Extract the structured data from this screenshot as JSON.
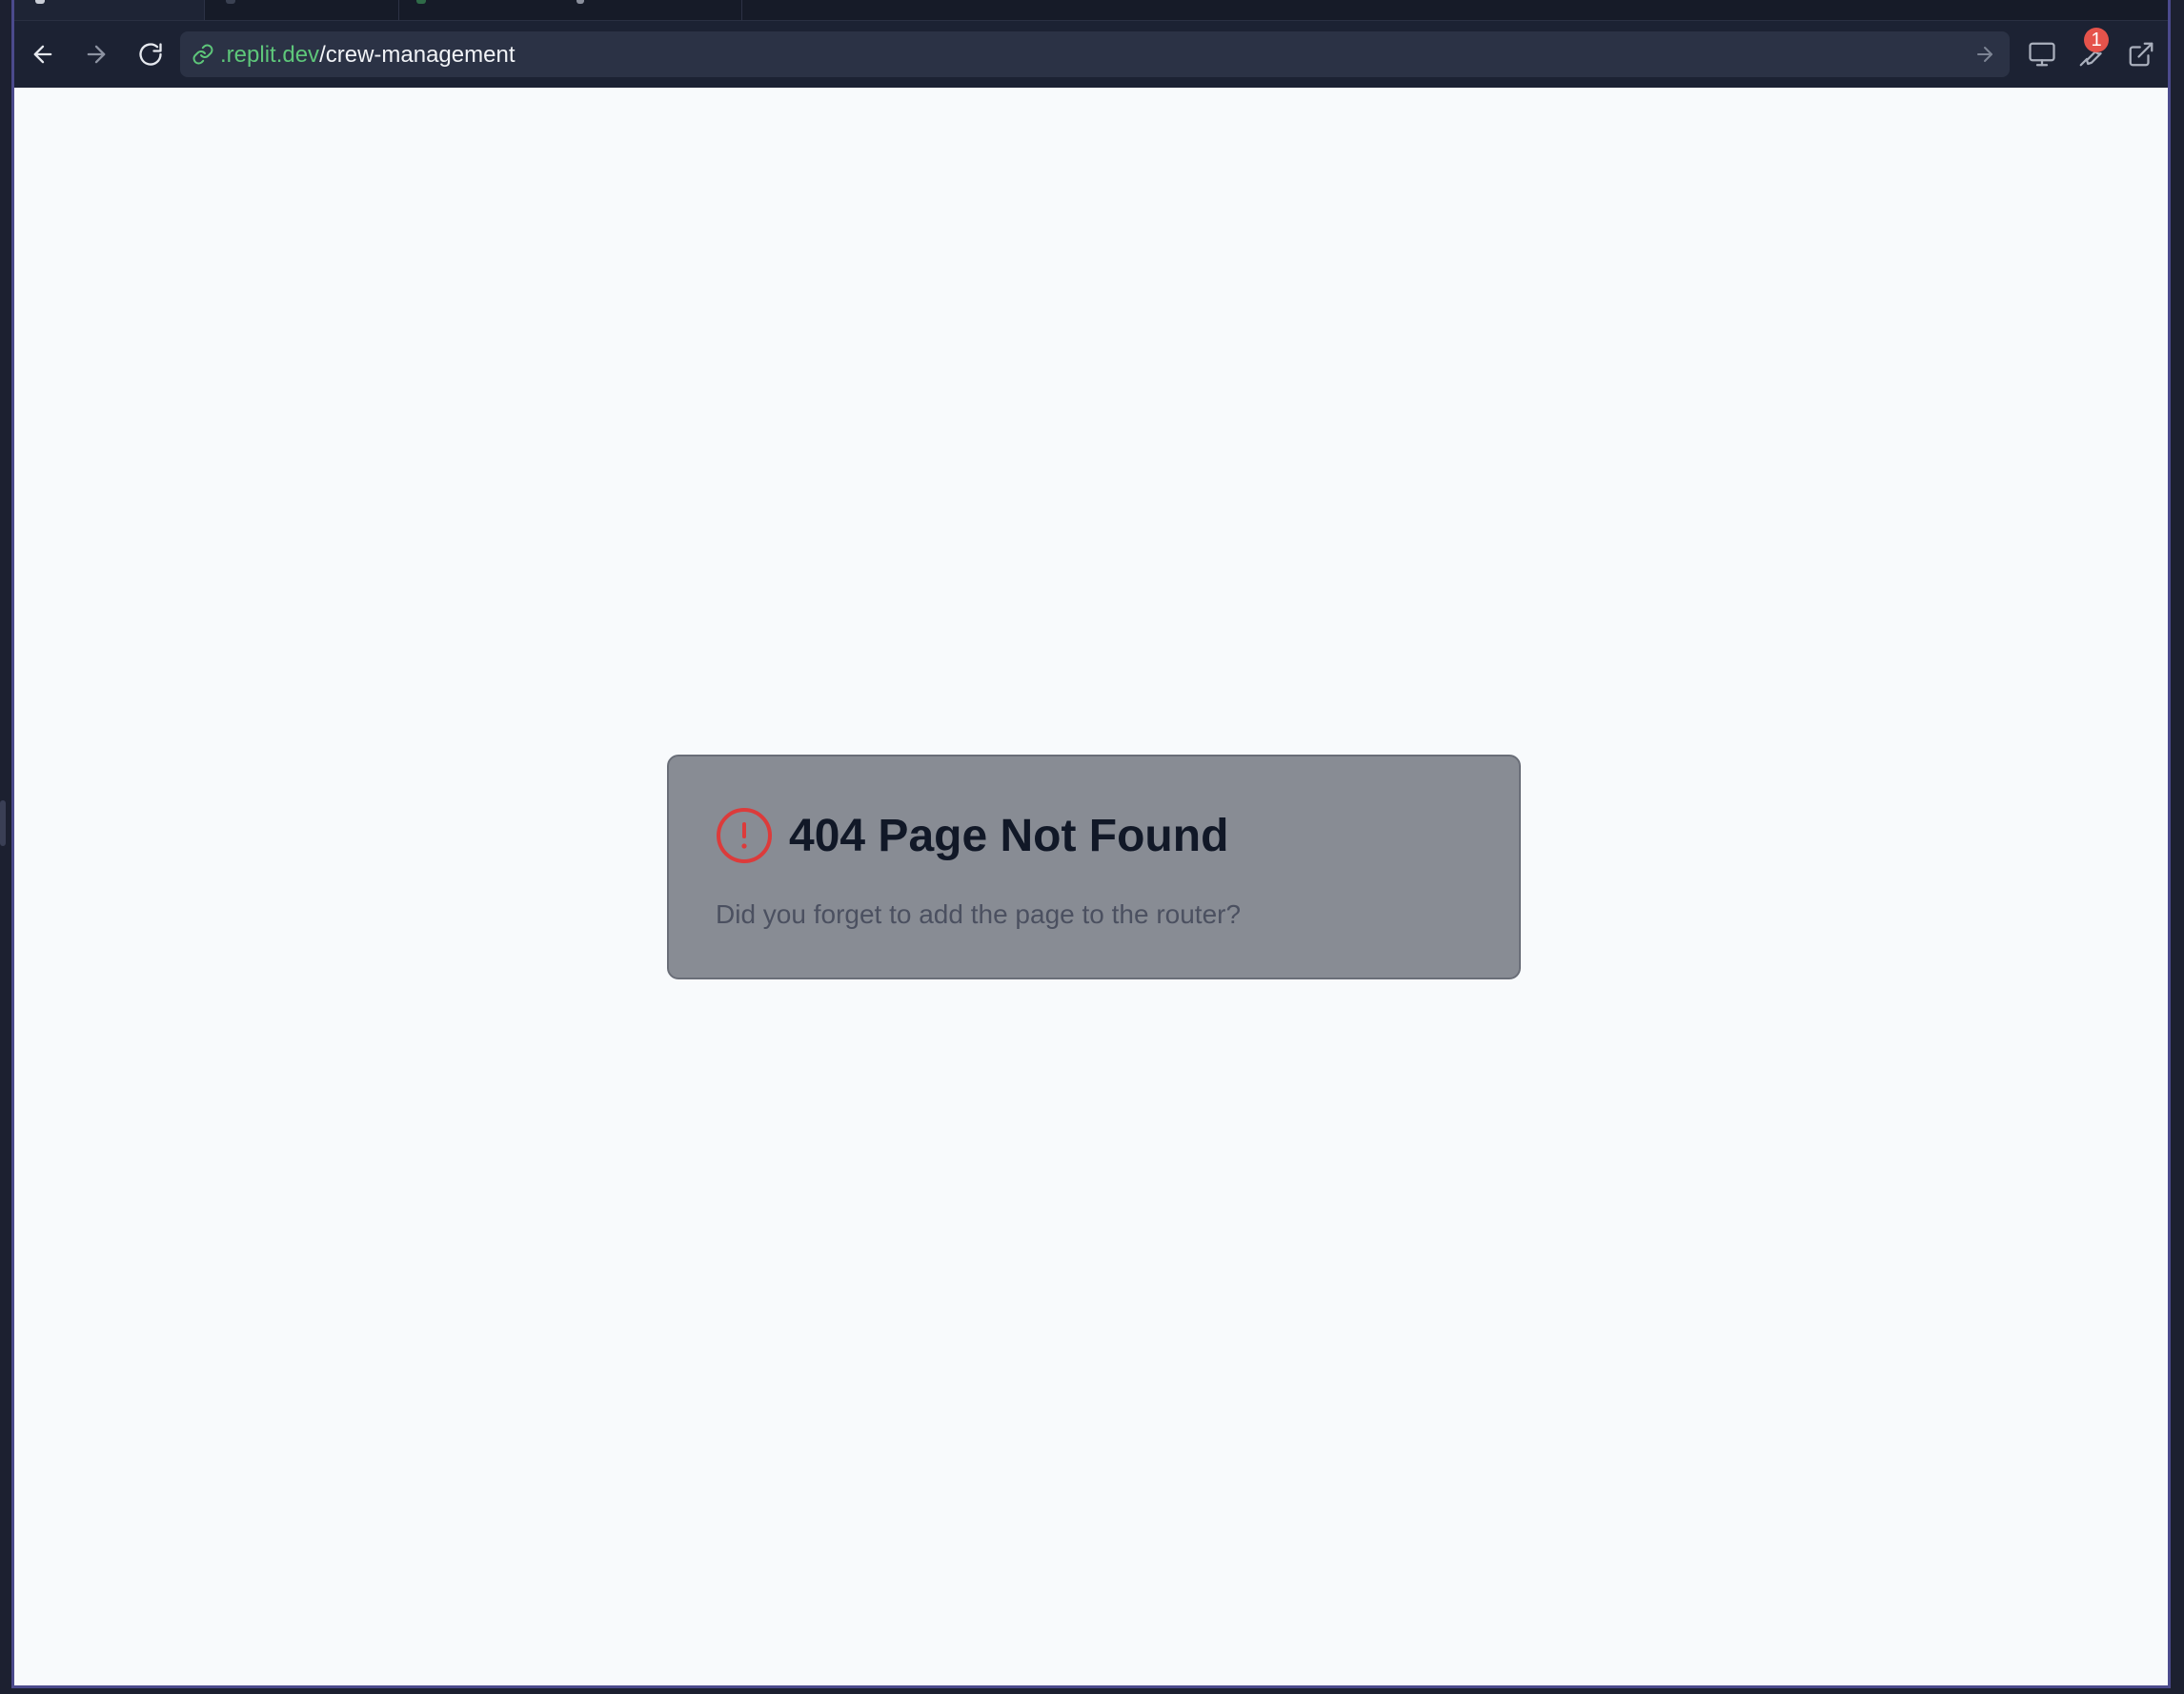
{
  "browser": {
    "url_host": ".replit.dev",
    "url_path": "/crew-management",
    "notification_count": "1",
    "accent_color": "#4b4a8c"
  },
  "icons": {
    "back": "arrow-left-icon",
    "forward": "arrow-right-icon",
    "reload": "reload-icon",
    "link": "link-icon",
    "go": "arrow-right-icon",
    "devices": "monitor-icon",
    "devtools": "wrench-icon",
    "external": "external-link-icon"
  },
  "page": {
    "title": "404 Page Not Found",
    "message": "Did you forget to add the page to the router?",
    "error_color": "#dc3b3b"
  }
}
